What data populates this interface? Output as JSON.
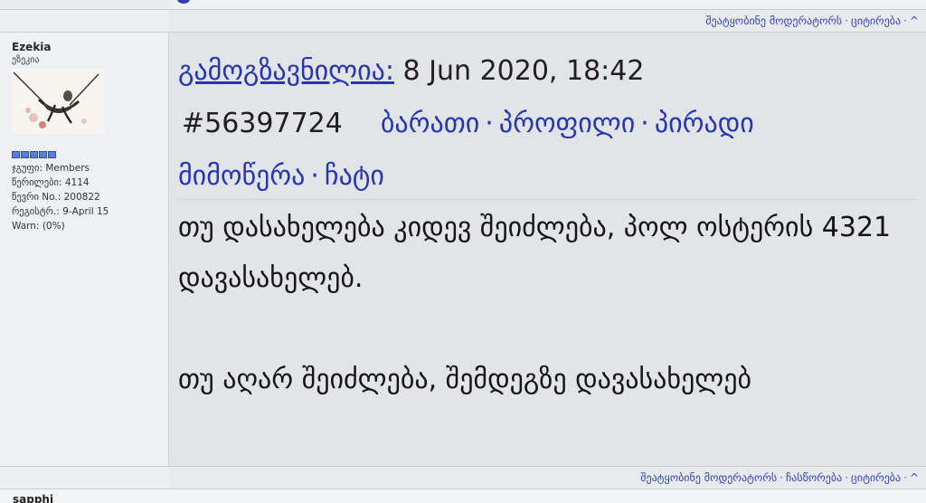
{
  "action_bar_top": {
    "links": [
      "შეატყობინე მოდერატორს",
      "ციტირება"
    ],
    "separator": "·",
    "up_arrow": "^"
  },
  "post": {
    "user": {
      "name": "Ezekia",
      "title": "ეზეკია",
      "rank_dots": 5,
      "stats": {
        "group_label": "ჯგუფი:",
        "group_value": "Members",
        "posts_label": "წერილები:",
        "posts_value": "4114",
        "member_no_label": "წევრი No.:",
        "member_no_value": "200822",
        "registered_label": "რეგისტრ.:",
        "registered_value": "9-April 15",
        "warn_label": "Warn:",
        "warn_value": "(0%)"
      }
    },
    "header": {
      "sent_label": "გამოგზავნილია:",
      "date": "8 Jun 2020, 18:42",
      "post_id": "#56397724",
      "links": [
        "ბარათი",
        "პროფილი",
        "პირადი მიმოწერა",
        "ჩატი"
      ],
      "separator": "·"
    },
    "body": {
      "paragraph1": "თუ დასახელება კიდევ შეიძლება, პოლ ოსტერის 4321 დავასახელებ.",
      "paragraph2": "თუ აღარ შეიძლება, შემდეგზე დავასახელებ"
    }
  },
  "action_bar_bottom": {
    "links": [
      "შეატყობინე მოდერატორს",
      "ჩასწორება",
      "ციტირება"
    ],
    "separator": "·",
    "up_arrow": "^"
  },
  "next_post": {
    "name_partial": "sapphi"
  },
  "colors": {
    "link": "#2436b3",
    "content_bg": "#e2e4e7",
    "sidebar_bg": "#eef0f3",
    "rank_dot": "#5b7fd6"
  }
}
